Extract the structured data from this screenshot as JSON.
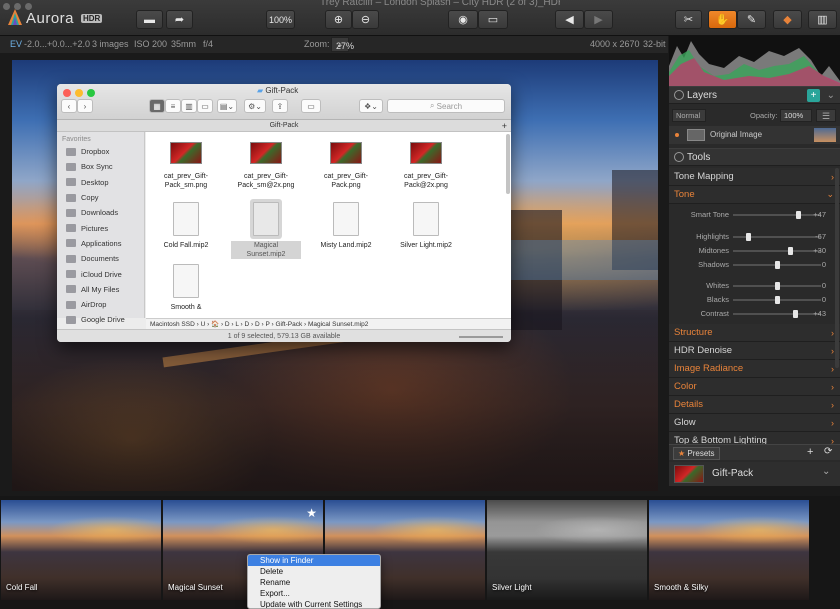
{
  "app": {
    "logo": "Aurora",
    "logo_badge": "HDR",
    "logo_sup": "",
    "window_title": "Trey Ratcliff – London Splash – City HDR (2 of 3)_HDR"
  },
  "toolbar": {
    "zoom_100": "100%"
  },
  "infobar": {
    "ev": "EV",
    "ev_values": "-2.0...+0.0...+2.0",
    "images": "3 images",
    "iso": "ISO 200",
    "focal": "35mm",
    "aperture": "f/4",
    "zoom_label": "Zoom:",
    "zoom_value": "27%",
    "dimensions": "4000 x 2670",
    "bits": "32-bit"
  },
  "finder": {
    "title": "Gift-Pack",
    "path_header": "Gift-Pack",
    "search_placeholder": "Search",
    "favorites_label": "Favorites",
    "sidebar": [
      {
        "label": "Dropbox",
        "icon": "dropbox-icon"
      },
      {
        "label": "Box Sync",
        "icon": "folder-icon"
      },
      {
        "label": "Desktop",
        "icon": "folder-icon"
      },
      {
        "label": "Copy",
        "icon": "folder-icon"
      },
      {
        "label": "Downloads",
        "icon": "downloads-icon"
      },
      {
        "label": "Pictures",
        "icon": "folder-icon"
      },
      {
        "label": "Applications",
        "icon": "applications-icon"
      },
      {
        "label": "Documents",
        "icon": "folder-icon"
      },
      {
        "label": "iCloud Drive",
        "icon": "cloud-icon"
      },
      {
        "label": "All My Files",
        "icon": "files-icon"
      },
      {
        "label": "AirDrop",
        "icon": "airdrop-icon"
      },
      {
        "label": "Google Drive",
        "icon": "folder-icon"
      }
    ],
    "files": [
      {
        "name": "cat_prev_Gift-Pack_sm.png",
        "line1": "cat_prev_Gift-",
        "line2": "Pack_sm.png",
        "kind": "image"
      },
      {
        "name": "cat_prev_Gift-Pack_sm@2x.png",
        "line1": "cat_prev_Gift-",
        "line2": "Pack_sm@2x.png",
        "kind": "image"
      },
      {
        "name": "cat_prev_Gift-Pack.png",
        "line1": "cat_prev_Gift-",
        "line2": "Pack.png",
        "kind": "image"
      },
      {
        "name": "cat_prev_Gift-Pack@2x.png",
        "line1": "cat_prev_Gift-",
        "line2": "Pack@2x.png",
        "kind": "image"
      },
      {
        "name": "Cold Fall.mip2",
        "line1": "Cold Fall.mip2",
        "line2": "",
        "kind": "doc"
      },
      {
        "name": "Magical Sunset.mip2",
        "line1": "Magical",
        "line2": "Sunset.mip2",
        "kind": "doc",
        "selected": true
      },
      {
        "name": "Misty Land.mip2",
        "line1": "Misty Land.mip2",
        "line2": "",
        "kind": "doc"
      },
      {
        "name": "Silver Light.mip2",
        "line1": "Silver Light.mip2",
        "line2": "",
        "kind": "doc"
      },
      {
        "name": "Smooth & ...",
        "line1": "Smooth &",
        "line2": "",
        "kind": "doc"
      }
    ],
    "pathbar": "Macintosh SSD  ›  U  ›  🏠  ›  D  ›  L  ›  D  ›  D  ›  P  ›  Gift-Pack  ›  Magical Sunset.mip2",
    "status": "1 of 9 selected, 579.13 GB available"
  },
  "right_panel": {
    "layers_title": "Layers",
    "blend_mode": "Normal",
    "opacity_label": "Opacity:",
    "opacity_value": "100%",
    "layer_name": "Original Image",
    "tools_title": "Tools",
    "tone_mapping": "Tone Mapping",
    "tone": "Tone",
    "sliders": [
      {
        "label": "Smart Tone",
        "value": "+47",
        "pos": 0.74,
        "group": 1
      },
      {
        "label": "Highlights",
        "value": "-67",
        "pos": 0.17,
        "group": 2
      },
      {
        "label": "Midtones",
        "value": "+30",
        "pos": 0.65,
        "group": 2
      },
      {
        "label": "Shadows",
        "value": "0",
        "pos": 0.5,
        "group": 2
      },
      {
        "label": "Whites",
        "value": "0",
        "pos": 0.5,
        "group": 3
      },
      {
        "label": "Blacks",
        "value": "0",
        "pos": 0.5,
        "group": 3
      },
      {
        "label": "Contrast",
        "value": "+43",
        "pos": 0.71,
        "group": 3
      }
    ],
    "categories": [
      {
        "label": "Structure",
        "color": "orange"
      },
      {
        "label": "HDR Denoise",
        "color": "white"
      },
      {
        "label": "Image Radiance",
        "color": "orange"
      },
      {
        "label": "Color",
        "color": "orange"
      },
      {
        "label": "Details",
        "color": "orange"
      },
      {
        "label": "Glow",
        "color": "white"
      },
      {
        "label": "Top & Bottom Lighting",
        "color": "white"
      }
    ],
    "presets_label": "Presets",
    "preset_name": "Gift-Pack"
  },
  "filmstrip": [
    {
      "label": "Cold Fall",
      "bw": false
    },
    {
      "label": "Magical Sunset",
      "bw": false,
      "starred": true
    },
    {
      "label": "",
      "bw": false
    },
    {
      "label": "Silver Light",
      "bw": true
    },
    {
      "label": "Smooth & Silky",
      "bw": false
    }
  ],
  "context_menu": [
    {
      "label": "Show in Finder",
      "highlighted": true
    },
    {
      "label": "Delete"
    },
    {
      "label": "Rename"
    },
    {
      "label": "Export..."
    },
    {
      "label": "Update with Current Settings"
    }
  ],
  "colors": {
    "accent": "#e8833a",
    "teal": "#2aa59a",
    "selection_blue": "#3d80e2"
  }
}
